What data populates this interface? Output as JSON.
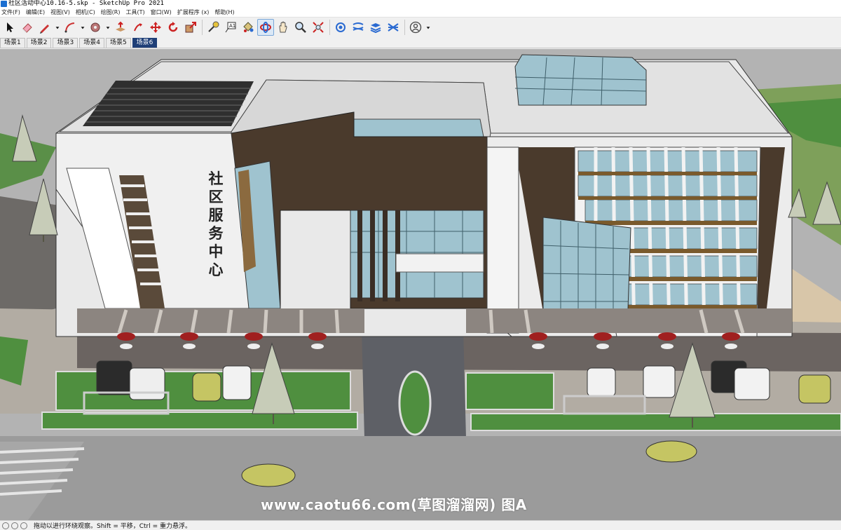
{
  "window": {
    "title": "社区活动中心10.16-5.skp - SketchUp Pro 2021"
  },
  "menu": [
    {
      "label": "文件(F)"
    },
    {
      "label": "编辑(E)"
    },
    {
      "label": "视图(V)"
    },
    {
      "label": "相机(C)"
    },
    {
      "label": "绘图(R)"
    },
    {
      "label": "工具(T)"
    },
    {
      "label": "窗口(W)"
    },
    {
      "label": "扩展程序 (x)"
    },
    {
      "label": "帮助(H)"
    }
  ],
  "toolbar": {
    "tools": [
      {
        "icon": "select-arrow-icon"
      },
      {
        "icon": "eraser-icon"
      },
      {
        "icon": "pencil-line-icon"
      },
      {
        "icon": "arc-icon"
      },
      {
        "icon": "shapes-icon"
      },
      {
        "icon": "push-pull-icon"
      },
      {
        "icon": "move-icon"
      },
      {
        "icon": "rotate-icon"
      },
      {
        "icon": "scale-icon"
      },
      {
        "icon": "tape-measure-icon"
      },
      {
        "icon": "text-icon"
      },
      {
        "icon": "paint-bucket-icon"
      },
      {
        "icon": "orbit-icon"
      },
      {
        "icon": "pan-icon"
      },
      {
        "icon": "zoom-icon"
      },
      {
        "icon": "zoom-extents-icon"
      },
      {
        "icon": "warehouse-icon"
      },
      {
        "icon": "extension-icon"
      },
      {
        "icon": "layers-icon"
      },
      {
        "icon": "sandbox-icon"
      },
      {
        "icon": "account-icon"
      }
    ],
    "active_tool": "orbit-icon"
  },
  "scenes": {
    "tabs": [
      {
        "label": "场景1"
      },
      {
        "label": "场景2"
      },
      {
        "label": "场景3"
      },
      {
        "label": "场景4"
      },
      {
        "label": "场景5"
      },
      {
        "label": "场景6"
      }
    ],
    "active_index": 5
  },
  "viewport": {
    "sign_text": [
      "社",
      "区",
      "服",
      "务",
      "中",
      "心"
    ],
    "watermark": "www.caotu66.com(草图溜溜网) 图A"
  },
  "status": {
    "text": "拖动以进行环绕观察。Shift = 平移，Ctrl = 重力悬浮。"
  },
  "colors": {
    "accent": "#1f3f77",
    "building_white": "#e9e9e9",
    "wall_dark_brown": "#4a3a2c",
    "glass": "#9fc3cf",
    "grass": "#4f8f3f",
    "road": "#9b9b9b",
    "plaza": "#6b6461"
  }
}
